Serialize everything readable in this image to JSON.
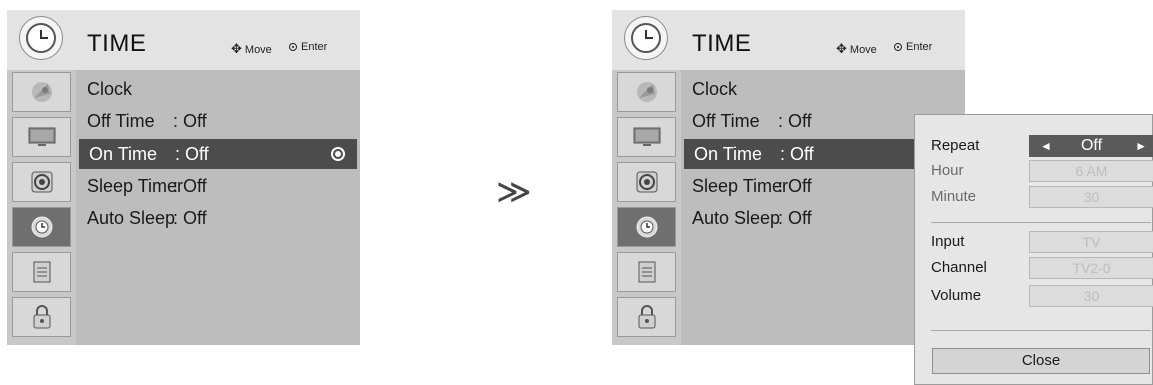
{
  "menu_title": "TIME",
  "hints": {
    "move": "Move",
    "enter": "Enter"
  },
  "menu_items": [
    {
      "label": "Clock",
      "value": ""
    },
    {
      "label": "Off Time",
      "value": ": Off"
    },
    {
      "label": "On Time",
      "value": ": Off"
    },
    {
      "label": "Sleep Timer",
      "value": ": Off"
    },
    {
      "label": "Auto Sleep",
      "value": ": Off"
    }
  ],
  "sidebar_icons": [
    "satellite-icon",
    "picture-icon",
    "audio-icon",
    "time-icon",
    "option-icon",
    "lock-icon"
  ],
  "arrow": "≫",
  "popup": {
    "repeat_label": "Repeat",
    "repeat_value": "Off",
    "hour_label": "Hour",
    "hour_value": "6 AM",
    "minute_label": "Minute",
    "minute_value": "30",
    "input_label": "Input",
    "input_value": "TV",
    "channel_label": "Channel",
    "channel_value": "TV2-0",
    "volume_label": "Volume",
    "volume_value": "30",
    "close_label": "Close"
  },
  "colors": {
    "panel": "#c8c8c8",
    "header": "#e3e3e3",
    "selected": "#4c4c4c",
    "popup": "#e6e6e6"
  }
}
